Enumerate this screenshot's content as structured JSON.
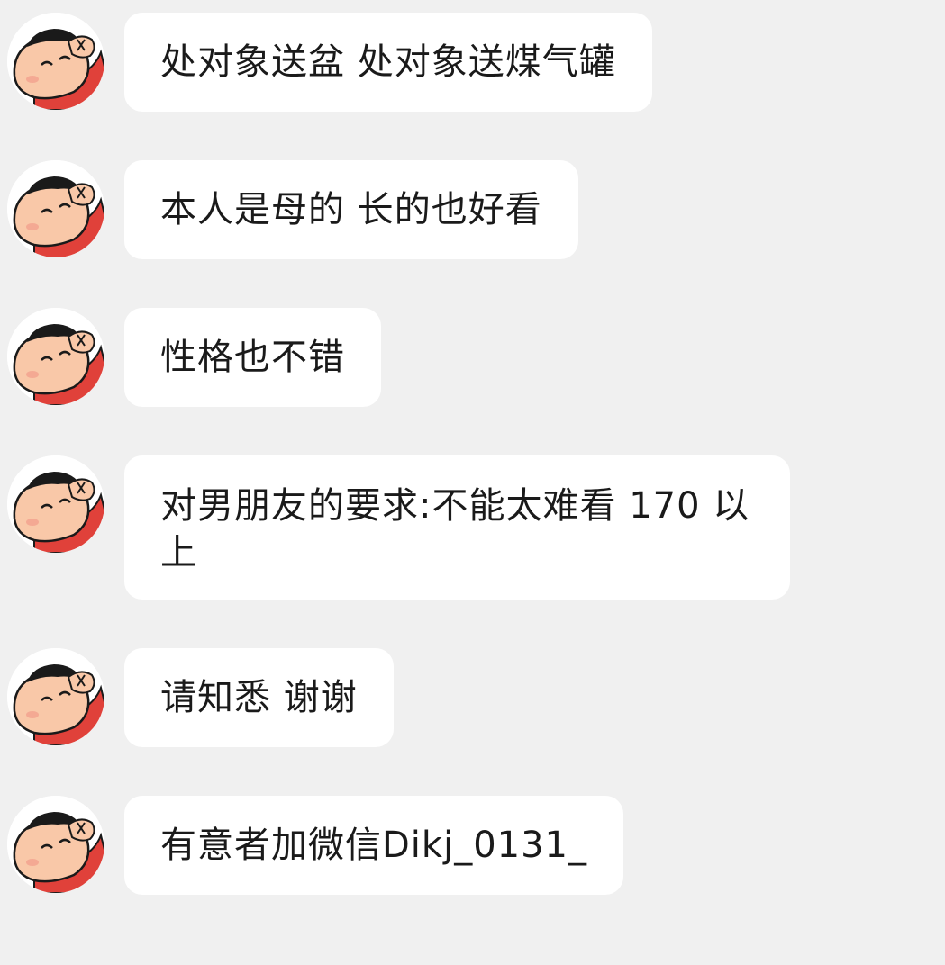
{
  "chat": {
    "messages": [
      {
        "sender": "avatar",
        "text": "处对象送盆 处对象送煤气罐"
      },
      {
        "sender": "avatar",
        "text": "本人是母的 长的也好看"
      },
      {
        "sender": "avatar",
        "text": "性格也不错"
      },
      {
        "sender": "avatar",
        "text": "对男朋友的要求:不能太难看 170 以上"
      },
      {
        "sender": "avatar",
        "text": "请知悉 谢谢"
      },
      {
        "sender": "avatar",
        "text": "有意者加微信Dikj_0131_"
      }
    ]
  },
  "colors": {
    "background": "#f0f0f0",
    "bubble": "#ffffff",
    "text": "#1a1a1a",
    "avatar_shirt": "#e0413a",
    "avatar_skin": "#f9c8a8"
  },
  "icons": {
    "avatar": "crayon-shin-chan-avatar-icon"
  }
}
